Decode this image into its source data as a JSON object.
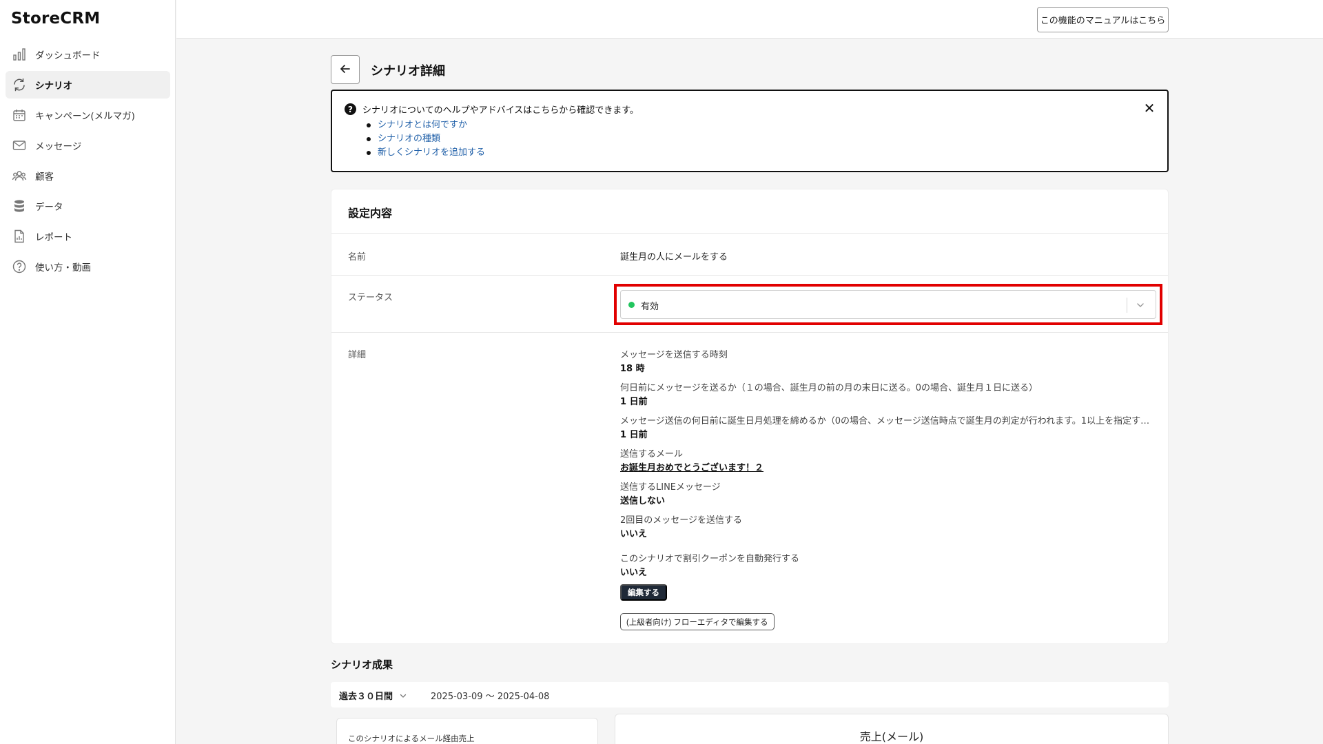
{
  "app": {
    "logo": "StoreCRM"
  },
  "sidebar": {
    "items": [
      {
        "label": "ダッシュボード",
        "icon": "bar-chart-icon",
        "active": false
      },
      {
        "label": "シナリオ",
        "icon": "refresh-icon",
        "active": true
      },
      {
        "label": "キャンペーン(メルマガ)",
        "icon": "calendar-icon",
        "active": false
      },
      {
        "label": "メッセージ",
        "icon": "mail-icon",
        "active": false
      },
      {
        "label": "顧客",
        "icon": "users-icon",
        "active": false
      },
      {
        "label": "データ",
        "icon": "database-icon",
        "active": false
      },
      {
        "label": "レポート",
        "icon": "report-icon",
        "active": false
      },
      {
        "label": "使い方・動画",
        "icon": "help-circle-icon",
        "active": false
      }
    ]
  },
  "header": {
    "manual_button": "この機能のマニュアルはこちら"
  },
  "page": {
    "title": "シナリオ詳細"
  },
  "help": {
    "heading": "シナリオについてのヘルプやアドバイスはこちらから確認できます。",
    "links": [
      "シナリオとは何ですか",
      "シナリオの種類",
      "新しくシナリオを追加する"
    ]
  },
  "settings": {
    "title": "設定内容",
    "name_label": "名前",
    "name_value": "誕生月の人にメールをする",
    "status_label": "ステータス",
    "status_value": "有効",
    "status_color": "#22c55e",
    "detail_label": "詳細",
    "details": [
      {
        "label": "メッセージを送信する時刻",
        "value": "18 時"
      },
      {
        "label": "何日前にメッセージを送るか（１の場合、誕生月の前の月の末日に送る。0の場合、誕生月１日に送る）",
        "value": "1 日前"
      },
      {
        "label": "メッセージ送信の何日前に誕生日月処理を締めるか（0の場合、メッセージ送信時点で誕生月の判定が行われます。1以上を指定すると、…",
        "value": "1 日前"
      },
      {
        "label": "送信するメール",
        "value": "お誕生月おめでとうございます！２"
      },
      {
        "label": "送信するLINEメッセージ",
        "value": "送信しない"
      },
      {
        "label": "2回目のメッセージを送信する",
        "value": "いいえ"
      },
      {
        "label": "このシナリオで割引クーポンを自動発行する",
        "value": "いいえ"
      }
    ],
    "edit_button": "編集する",
    "flow_button": "(上級者向け) フローエディタで編集する"
  },
  "results": {
    "title": "シナリオ成果",
    "period": "過去３０日間",
    "range": "2025-03-09 〜 2025-04-08",
    "metric_label": "このシナリオによるメール経由売上",
    "chart_title": "売上(メール)"
  },
  "accent": {
    "highlight_border": "#e10000",
    "dark_button": "#1f2937",
    "link": "#1f5fa8"
  }
}
